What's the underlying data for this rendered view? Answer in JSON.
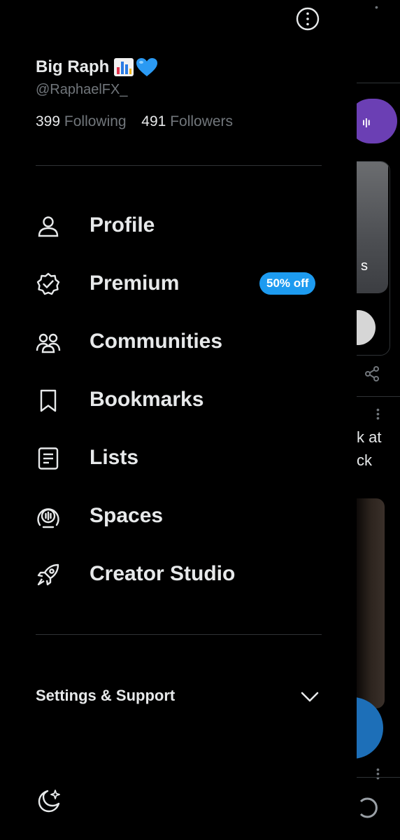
{
  "profile": {
    "name": "Big Raph",
    "name_emojis": [
      "bar-chart-emoji",
      "blue-heart-emoji"
    ],
    "handle": "@RaphaelFX_",
    "following_count": "399",
    "following_label": "Following",
    "followers_count": "491",
    "followers_label": "Followers"
  },
  "menu": {
    "items": [
      {
        "label": "Profile",
        "icon": "person-icon"
      },
      {
        "label": "Premium",
        "icon": "verified-badge-icon",
        "badge": "50% off"
      },
      {
        "label": "Communities",
        "icon": "communities-icon"
      },
      {
        "label": "Bookmarks",
        "icon": "bookmark-icon"
      },
      {
        "label": "Lists",
        "icon": "list-icon"
      },
      {
        "label": "Spaces",
        "icon": "spaces-icon"
      },
      {
        "label": "Creator Studio",
        "icon": "rocket-icon"
      }
    ]
  },
  "settings": {
    "label": "Settings & Support",
    "icon": "chevron-down-icon"
  },
  "background_feed": {
    "card_text_fragment": "s",
    "tweet_text_fragment": "k at\nck"
  },
  "colors": {
    "background": "#000000",
    "text": "#e7e9ea",
    "muted": "#71767b",
    "divider": "#2f3336",
    "accent": "#1d9bf0",
    "spaces_purple": "#6b3fb4"
  }
}
